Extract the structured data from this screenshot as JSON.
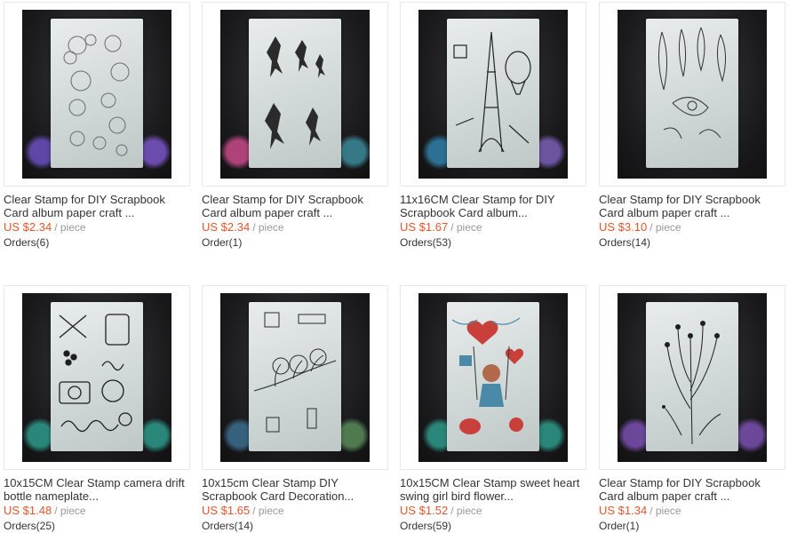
{
  "products": [
    {
      "title": "Clear Stamp for DIY Scrapbook Card album paper craft ...",
      "price": "US $2.34",
      "unit": "/ piece",
      "orders": "Orders(6)",
      "image": "owl-and-bear-stamps"
    },
    {
      "title": "Clear Stamp for DIY Scrapbook Card album paper craft ...",
      "price": "US $2.34",
      "unit": "/ piece",
      "orders": "Order(1)",
      "image": "fairy-silhouette-stamps"
    },
    {
      "title": "11x16CM Clear Stamp for DIY Scrapbook Card album...",
      "price": "US $1.67",
      "unit": "/ piece",
      "orders": "Orders(53)",
      "image": "eiffel-tower-stamps"
    },
    {
      "title": "Clear Stamp for DIY Scrapbook Card album paper craft ...",
      "price": "US $3.10",
      "unit": "/ piece",
      "orders": "Orders(14)",
      "image": "feather-stamps"
    },
    {
      "title": "10x15CM Clear Stamp camera drift bottle nameplate...",
      "price": "US $1.48",
      "unit": "/ piece",
      "orders": "Orders(25)",
      "image": "camera-time-dream-stamps"
    },
    {
      "title": "10x15cm Clear Stamp DIY Scrapbook Card Decoration...",
      "price": "US $1.65",
      "unit": "/ piece",
      "orders": "Orders(14)",
      "image": "tree-branch-stamps"
    },
    {
      "title": "10x15CM Clear Stamp sweet heart swing girl bird flower...",
      "price": "US $1.52",
      "unit": "/ piece",
      "orders": "Orders(59)",
      "image": "swing-girl-stamps"
    },
    {
      "title": "Clear Stamp for DIY Scrapbook Card album paper craft ...",
      "price": "US $1.34",
      "unit": "/ piece",
      "orders": "Order(1)",
      "image": "wildflower-stamp"
    }
  ],
  "colors": {
    "price": "#e5552d",
    "unit": "#999999",
    "text": "#333333",
    "border": "#e8e8e8"
  }
}
